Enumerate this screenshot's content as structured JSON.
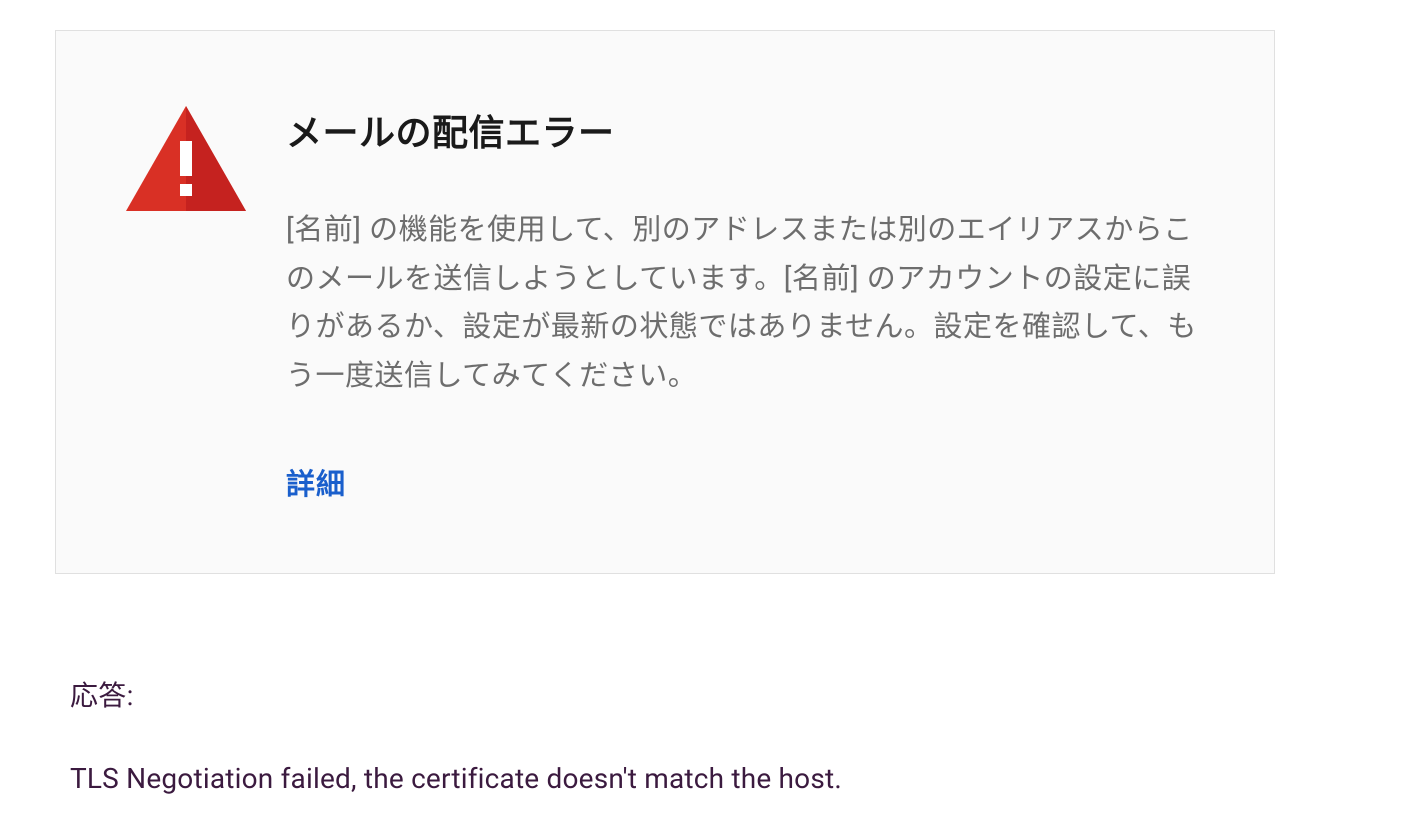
{
  "error": {
    "title": "メールの配信エラー",
    "description": "[名前] の機能を使用して、別のアドレスまたは別のエイリアスからこのメールを送信しようとしています。[名前] のアカウントの設定に誤りがあるか、設定が最新の状態ではありません。設定を確認して、もう一度送信してみてください。",
    "details_link": "詳細",
    "icon_name": "warning-triangle-icon",
    "colors": {
      "icon_fill": "#d93025",
      "icon_shadow": "#b1271b",
      "link_color": "#1a5fcc"
    }
  },
  "response": {
    "label": "応答:",
    "text": "TLS Negotiation failed, the certificate doesn't match the host."
  }
}
